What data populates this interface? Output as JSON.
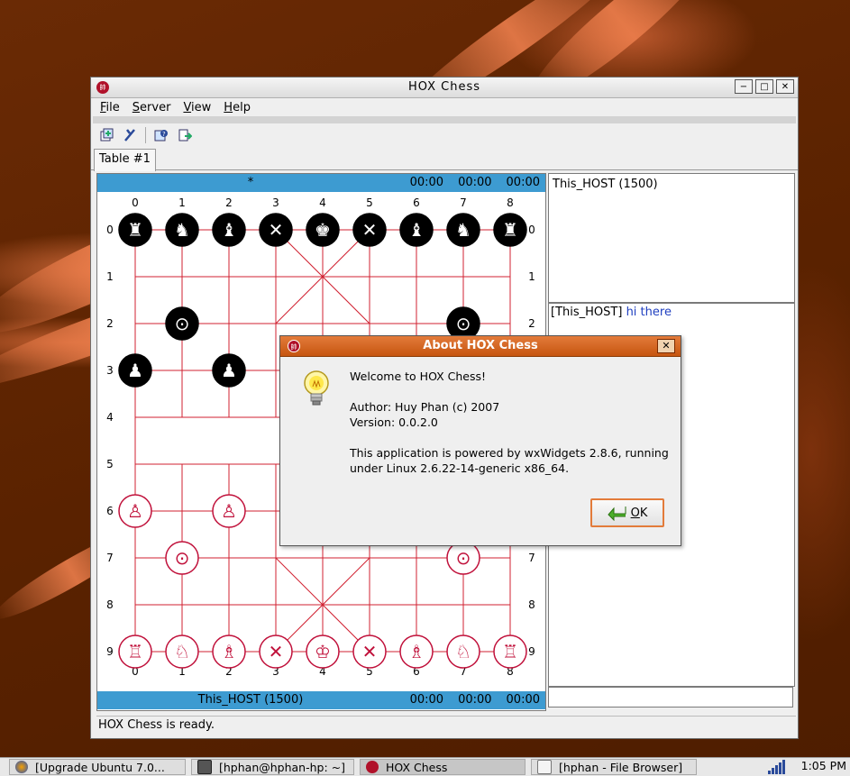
{
  "window": {
    "title": "HOX Chess",
    "controls": {
      "minimize": "−",
      "maximize": "□",
      "close": "✕"
    }
  },
  "menu": [
    "File",
    "Server",
    "View",
    "Help"
  ],
  "toolbar": {
    "icons": [
      "open-table-icon",
      "close-table-icon",
      "help-icon",
      "export-icon"
    ]
  },
  "tab": {
    "label": "Table #1"
  },
  "board": {
    "top_bar": {
      "label": "*",
      "timers": [
        "00:00",
        "00:00",
        "00:00"
      ]
    },
    "bottom_bar": {
      "label": "This_HOST (1500)",
      "timers": [
        "00:00",
        "00:00",
        "00:00"
      ]
    },
    "col_labels": [
      "0",
      "1",
      "2",
      "3",
      "4",
      "5",
      "6",
      "7",
      "8"
    ],
    "row_labels": [
      "0",
      "1",
      "2",
      "3",
      "4",
      "5",
      "6",
      "7",
      "8",
      "9"
    ],
    "black_pieces": [
      {
        "glyph": "♜",
        "col": 0,
        "row": 0,
        "name": "black-rook-icon"
      },
      {
        "glyph": "♞",
        "col": 1,
        "row": 0,
        "name": "black-horse-icon"
      },
      {
        "glyph": "♝",
        "col": 2,
        "row": 0,
        "name": "black-elephant-icon"
      },
      {
        "glyph": "✕",
        "col": 3,
        "row": 0,
        "name": "black-advisor-icon"
      },
      {
        "glyph": "♚",
        "col": 4,
        "row": 0,
        "name": "black-king-icon"
      },
      {
        "glyph": "✕",
        "col": 5,
        "row": 0,
        "name": "black-advisor-icon"
      },
      {
        "glyph": "♝",
        "col": 6,
        "row": 0,
        "name": "black-elephant-icon"
      },
      {
        "glyph": "♞",
        "col": 7,
        "row": 0,
        "name": "black-horse-icon"
      },
      {
        "glyph": "♜",
        "col": 8,
        "row": 0,
        "name": "black-rook-icon"
      },
      {
        "glyph": "⊙",
        "col": 1,
        "row": 2,
        "name": "black-cannon-icon"
      },
      {
        "glyph": "⊙",
        "col": 7,
        "row": 2,
        "name": "black-cannon-icon"
      },
      {
        "glyph": "♟",
        "col": 0,
        "row": 3,
        "name": "black-pawn-icon"
      },
      {
        "glyph": "♟",
        "col": 2,
        "row": 3,
        "name": "black-pawn-icon"
      }
    ],
    "red_pieces": [
      {
        "glyph": "♙",
        "col": 0,
        "row": 6,
        "name": "red-pawn-icon"
      },
      {
        "glyph": "♙",
        "col": 2,
        "row": 6,
        "name": "red-pawn-icon"
      },
      {
        "glyph": "⊙",
        "col": 1,
        "row": 7,
        "name": "red-cannon-icon"
      },
      {
        "glyph": "⊙",
        "col": 7,
        "row": 7,
        "name": "red-cannon-icon"
      },
      {
        "glyph": "♖",
        "col": 0,
        "row": 9,
        "name": "red-rook-icon"
      },
      {
        "glyph": "♘",
        "col": 1,
        "row": 9,
        "name": "red-horse-icon"
      },
      {
        "glyph": "♗",
        "col": 2,
        "row": 9,
        "name": "red-elephant-icon"
      },
      {
        "glyph": "✕",
        "col": 3,
        "row": 9,
        "name": "red-advisor-icon"
      },
      {
        "glyph": "♔",
        "col": 4,
        "row": 9,
        "name": "red-king-icon"
      },
      {
        "glyph": "✕",
        "col": 5,
        "row": 9,
        "name": "red-advisor-icon"
      },
      {
        "glyph": "♗",
        "col": 6,
        "row": 9,
        "name": "red-elephant-icon"
      },
      {
        "glyph": "♘",
        "col": 7,
        "row": 9,
        "name": "red-horse-icon"
      },
      {
        "glyph": "♖",
        "col": 8,
        "row": 9,
        "name": "red-rook-icon"
      }
    ],
    "colors": {
      "line": "#d02030",
      "bar": "#3d9bd1",
      "black_piece": "#000000",
      "red_piece": "#c0103a"
    }
  },
  "players": {
    "entry": "This_HOST (1500)"
  },
  "chat": {
    "sender": "[This_HOST]",
    "message": "hi there",
    "input_value": ""
  },
  "status": {
    "text": "HOX Chess is ready."
  },
  "about": {
    "title": "About HOX Chess",
    "close": "✕",
    "welcome": "Welcome to HOX Chess!",
    "author": "Author: Huy Phan (c) 2007",
    "version": "Version: 0.0.2.0",
    "powered_line1": "This application is powered by wxWidgets 2.8.6, running",
    "powered_line2": "under Linux 2.6.22-14-generic x86_64.",
    "ok_label": "OK"
  },
  "taskbar": {
    "items": [
      {
        "label": "[Upgrade Ubuntu 7.0...",
        "icon": "firefox-icon",
        "active": false
      },
      {
        "label": "[hphan@hphan-hp: ~]",
        "icon": "terminal-icon",
        "active": false
      },
      {
        "label": "HOX Chess",
        "icon": "hox-chess-icon",
        "active": true
      },
      {
        "label": "[hphan - File Browser]",
        "icon": "file-browser-icon",
        "active": false
      }
    ],
    "clock": "1:05 PM"
  }
}
